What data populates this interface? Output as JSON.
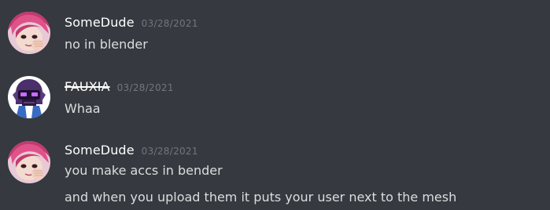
{
  "colors": {
    "background": "#36393f",
    "username": "#ffffff",
    "timestamp": "#72767d",
    "message_text": "#dcddde"
  },
  "messages": [
    {
      "author": "SomeDude",
      "timestamp": "03/28/2021",
      "avatar_icon": "anime-girl-avatar-icon",
      "lines": [
        "no in blender"
      ]
    },
    {
      "author": "FAUXIA",
      "author_style": "strikethrough",
      "timestamp": "03/28/2021",
      "avatar_icon": "purple-robot-avatar-icon",
      "lines": [
        "Whaa"
      ]
    },
    {
      "author": "SomeDude",
      "timestamp": "03/28/2021",
      "avatar_icon": "anime-girl-avatar-icon",
      "lines": [
        "you make accs in bender",
        "and when you upload them it puts your user next to the mesh"
      ]
    }
  ]
}
